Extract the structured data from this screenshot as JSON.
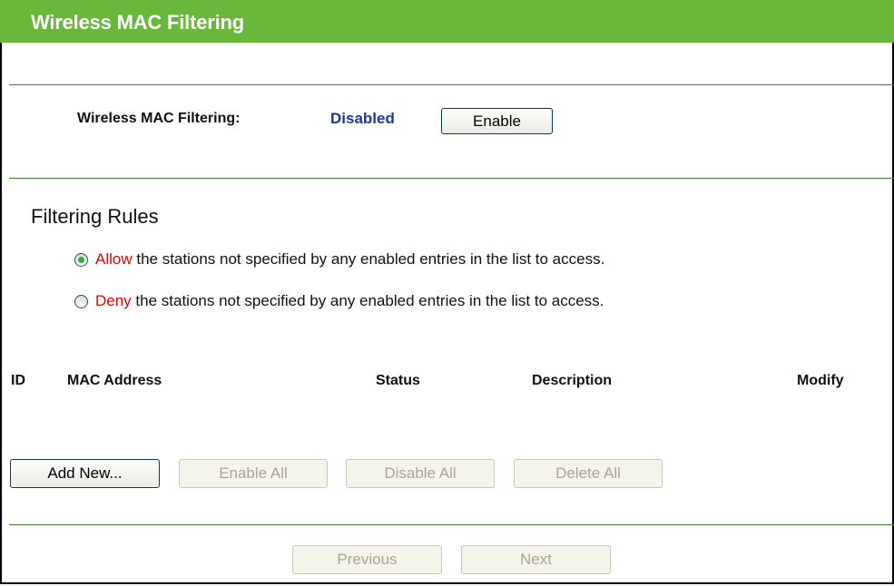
{
  "header": {
    "title": "Wireless MAC Filtering"
  },
  "filtering": {
    "label": "Wireless MAC Filtering:",
    "status": "Disabled",
    "toggle_button": "Enable"
  },
  "rules": {
    "heading": "Filtering Rules",
    "options": [
      {
        "keyword": "Allow",
        "text": " the stations not specified by any enabled entries in the list to access.",
        "selected": true
      },
      {
        "keyword": "Deny",
        "text": " the stations not specified by any enabled entries in the list to access.",
        "selected": false
      }
    ]
  },
  "table": {
    "columns": [
      "ID",
      "MAC Address",
      "Status",
      "Description",
      "Modify"
    ]
  },
  "actions": {
    "add_new": "Add New...",
    "enable_all": "Enable All",
    "disable_all": "Disable All",
    "delete_all": "Delete All"
  },
  "pagination": {
    "previous": "Previous",
    "next": "Next"
  },
  "colors": {
    "title_bar": "#69b83b",
    "divider": "#3f7f2f",
    "status_text": "#1a3a9c",
    "keyword_text": "#e60000"
  }
}
